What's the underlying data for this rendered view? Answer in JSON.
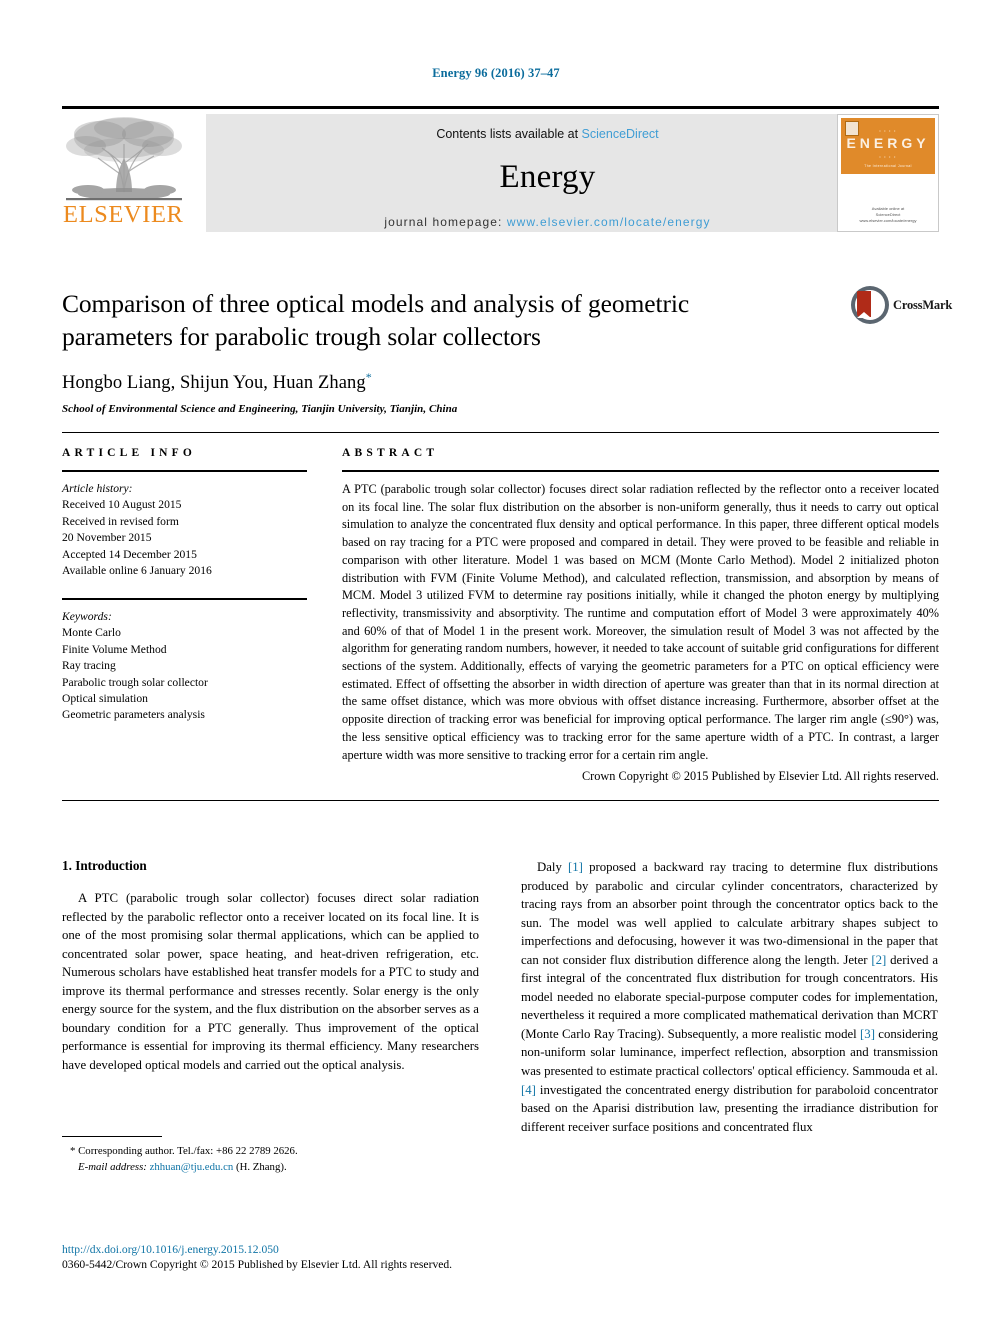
{
  "running_head": "Energy 96 (2016) 37–47",
  "masthead": {
    "publisher_name": "ELSEVIER",
    "contents_prefix": "Contents lists available at ",
    "contents_link": "ScienceDirect",
    "journal_name": "Energy",
    "homepage_prefix": "journal homepage: ",
    "homepage_url": "www.elsevier.com/locate/energy",
    "cover": {
      "banner_title": "ENERGY",
      "banner_top_row": "• • • •",
      "banner_bottom_row": "• • • •",
      "banner_subtitle": "The International Journal",
      "footer_line1": "Available online at",
      "footer_line2": "ScienceDirect",
      "footer_line3": "www.elsevier.com/locate/energy"
    }
  },
  "article": {
    "title": "Comparison of three optical models and analysis of geometric parameters for parabolic trough solar collectors",
    "authors": "Hongbo Liang, Shijun You, Huan Zhang",
    "corresponding_marker": "*",
    "affiliation": "School of Environmental Science and Engineering, Tianjin University, Tianjin, China",
    "crossmark_label": "CrossMark"
  },
  "article_info": {
    "heading": "ARTICLE INFO",
    "history_label": "Article history:",
    "history": [
      "Received 10 August 2015",
      "Received in revised form",
      "20 November 2015",
      "Accepted 14 December 2015",
      "Available online 6 January 2016"
    ],
    "keywords_label": "Keywords:",
    "keywords": [
      "Monte Carlo",
      "Finite Volume Method",
      "Ray tracing",
      "Parabolic trough solar collector",
      "Optical simulation",
      "Geometric parameters analysis"
    ]
  },
  "abstract": {
    "heading": "ABSTRACT",
    "text": "A PTC (parabolic trough solar collector) focuses direct solar radiation reflected by the reflector onto a receiver located on its focal line. The solar flux distribution on the absorber is non-uniform generally, thus it needs to carry out optical simulation to analyze the concentrated flux density and optical performance. In this paper, three different optical models based on ray tracing for a PTC were proposed and compared in detail. They were proved to be feasible and reliable in comparison with other literature. Model 1 was based on MCM (Monte Carlo Method). Model 2 initialized photon distribution with FVM (Finite Volume Method), and calculated reflection, transmission, and absorption by means of MCM. Model 3 utilized FVM to determine ray positions initially, while it changed the photon energy by multiplying reflectivity, transmissivity and absorptivity. The runtime and computation effort of Model 3 were approximately 40% and 60% of that of Model 1 in the present work. Moreover, the simulation result of Model 3 was not affected by the algorithm for generating random numbers, however, it needed to take account of suitable grid configurations for different sections of the system. Additionally, effects of varying the geometric parameters for a PTC on optical efficiency were estimated. Effect of offsetting the absorber in width direction of aperture was greater than that in its normal direction at the same offset distance, which was more obvious with offset distance increasing. Furthermore, absorber offset at the opposite direction of tracking error was beneficial for improving optical performance. The larger rim angle (≤90°) was, the less sensitive optical efficiency was to tracking error for the same aperture width of a PTC. In contrast, a larger aperture width was more sensitive to tracking error for a certain rim angle.",
    "copyright": "Crown Copyright © 2015 Published by Elsevier Ltd. All rights reserved."
  },
  "body": {
    "section_heading": "1. Introduction",
    "left_paragraph": "A PTC (parabolic trough solar collector) focuses direct solar radiation reflected by the parabolic reflector onto a receiver located on its focal line. It is one of the most promising solar thermal applications, which can be applied to concentrated solar power, space heating, and heat-driven refrigeration, etc. Numerous scholars have established heat transfer models for a PTC to study and improve its thermal performance and stresses recently. Solar energy is the only energy source for the system, and the flux distribution on the absorber serves as a boundary condition for a PTC generally. Thus improvement of the optical performance is essential for improving its thermal efficiency. Many researchers have developed optical models and carried out the optical analysis.",
    "right_paragraph_parts": {
      "p1": "Daly ",
      "r1": "[1]",
      "p2": " proposed a backward ray tracing to determine flux distributions produced by parabolic and circular cylinder concentrators, characterized by tracing rays from an absorber point through the concentrator optics back to the sun. The model was well applied to calculate arbitrary shapes subject to imperfections and defocusing, however it was two-dimensional in the paper that can not consider flux distribution difference along the length. Jeter ",
      "r2": "[2]",
      "p3": " derived a first integral of the concentrated flux distribution for trough concentrators. His model needed no elaborate special-purpose computer codes for implementation, nevertheless it required a more complicated mathematical derivation than MCRT (Monte Carlo Ray Tracing). Subsequently, a more realistic model ",
      "r3": "[3]",
      "p4": " considering non-uniform solar luminance, imperfect reflection, absorption and transmission was presented to estimate practical collectors' optical efficiency. Sammouda et al. ",
      "r4": "[4]",
      "p5": " investigated the concentrated energy distribution for paraboloid concentrator based on the Aparisi distribution law, presenting the irradiance distribution for different receiver surface positions and concentrated flux"
    }
  },
  "footnote": {
    "marker": "*",
    "corresponding": "Corresponding author. Tel./fax: +86 22 2789 2626.",
    "email_label": "E-mail address:",
    "email": "zhhuan@tju.edu.cn",
    "email_suffix": "(H. Zhang)."
  },
  "doi": {
    "link": "http://dx.doi.org/10.1016/j.energy.2015.12.050",
    "issn_line": "0360-5442/Crown Copyright © 2015 Published by Elsevier Ltd. All rights reserved."
  },
  "colors": {
    "link_blue": "#1074a6",
    "header_blue": "#0b6c9c",
    "elsevier_orange": "#ec8a1e",
    "band_gray": "#e6e6e6",
    "cover_orange": "#e08a2a"
  }
}
